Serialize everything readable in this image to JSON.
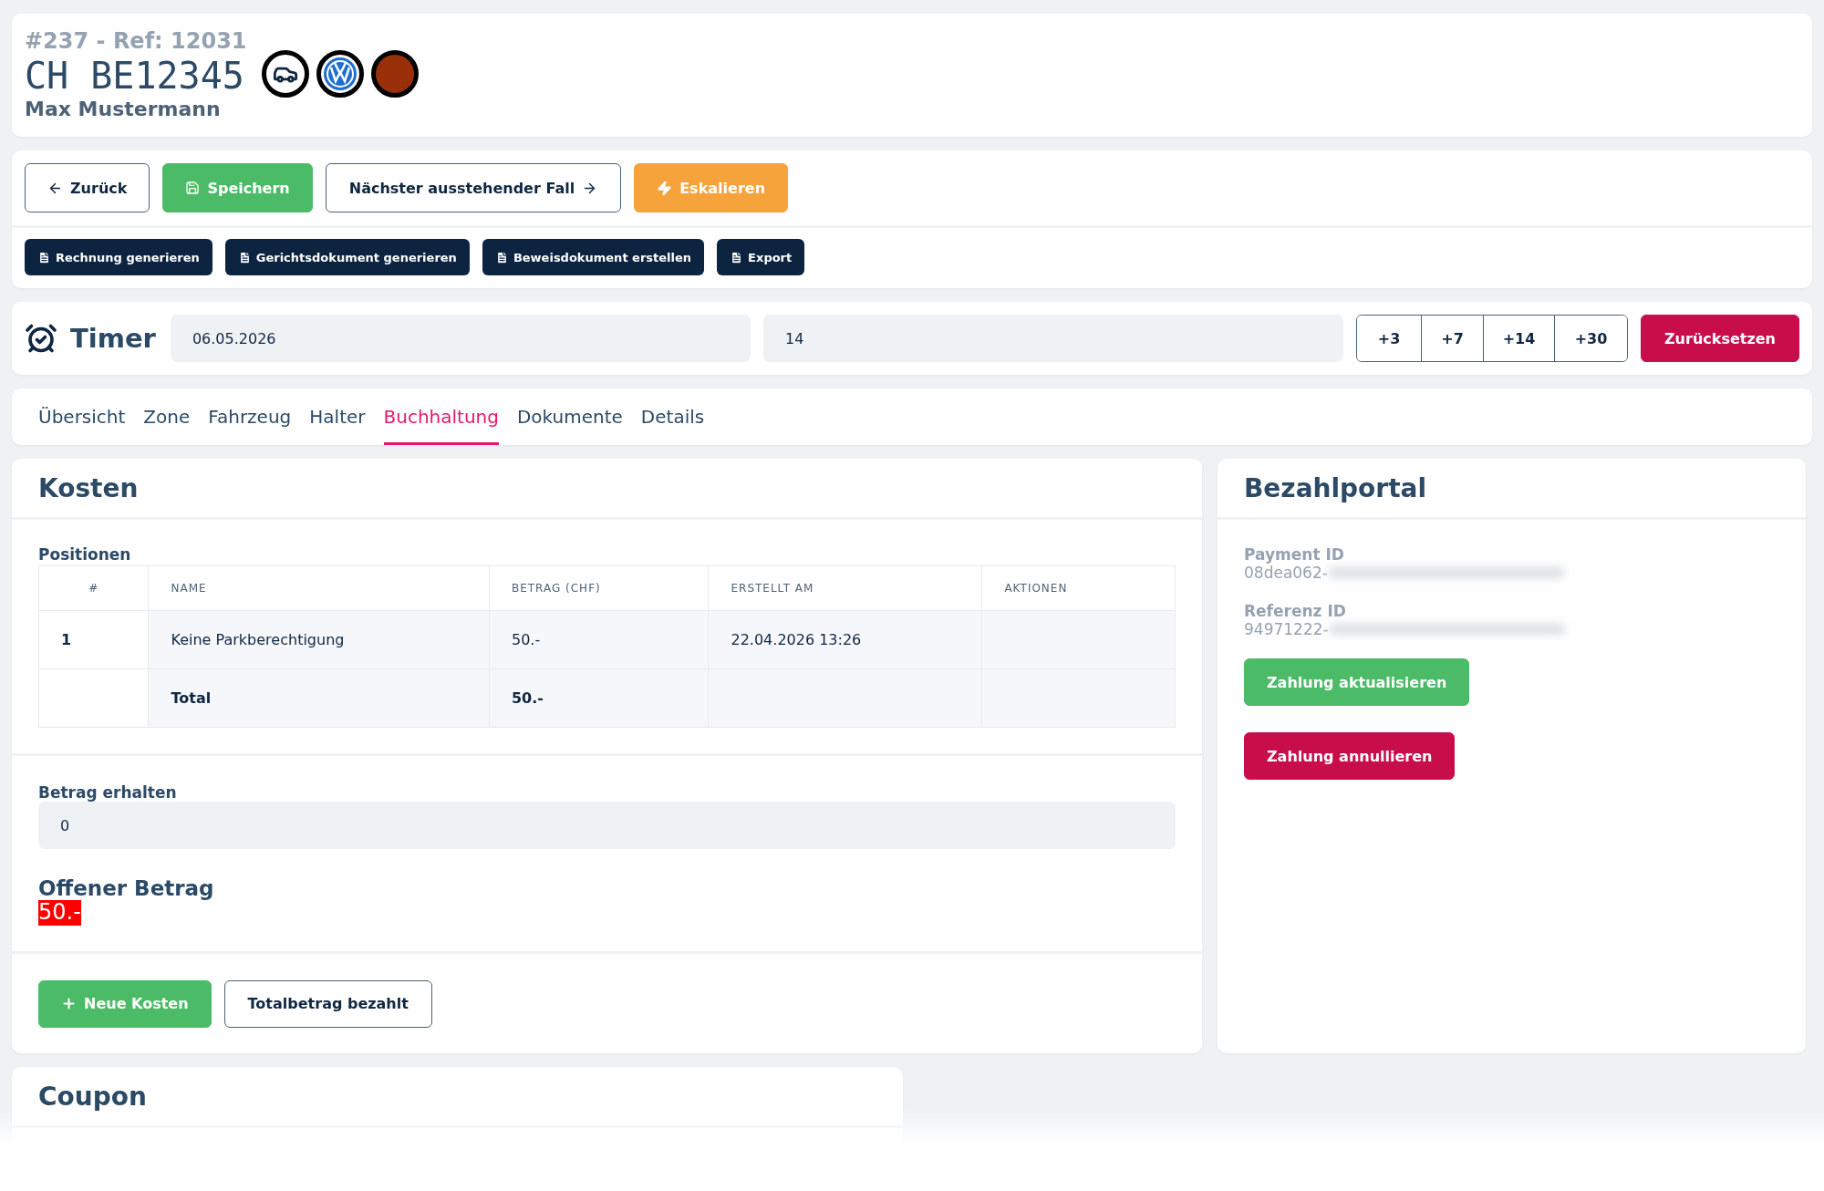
{
  "header": {
    "case_ref": "#237 - Ref: 12031",
    "plate": "CH BE12345",
    "owner": "Max Mustermann",
    "badges": [
      {
        "kind": "car"
      },
      {
        "kind": "brand"
      },
      {
        "kind": "color",
        "color": "#9a300a"
      }
    ]
  },
  "actions": [
    {
      "label": "Zurück",
      "kind": "back"
    },
    {
      "label": "Speichern",
      "kind": "save"
    },
    {
      "label": "Nächster ausstehender Fall",
      "kind": "next"
    },
    {
      "label": "Eskalieren",
      "kind": "escalate"
    }
  ],
  "documents": [
    {
      "label": "Rechnung generieren"
    },
    {
      "label": "Gerichtsdokument generieren"
    },
    {
      "label": "Beweisdokument erstellen"
    },
    {
      "label": "Export"
    }
  ],
  "timer": {
    "label": "Timer",
    "date": "06.05.2026",
    "days": "14",
    "increments": [
      "+3",
      "+7",
      "+14",
      "+30"
    ],
    "reset": "Zurücksetzen"
  },
  "tabs": [
    {
      "label": "Übersicht",
      "selected": false
    },
    {
      "label": "Zone",
      "selected": false
    },
    {
      "label": "Fahrzeug",
      "selected": false
    },
    {
      "label": "Halter",
      "selected": false
    },
    {
      "label": "Buchhaltung",
      "selected": true
    },
    {
      "label": "Dokumente",
      "selected": false
    },
    {
      "label": "Details",
      "selected": false
    }
  ],
  "costs": {
    "title": "Kosten",
    "table_title": "Positionen",
    "columns": [
      "#",
      "NAME",
      "BETRAG (CHF)",
      "ERSTELLT AM",
      "AKTIONEN"
    ],
    "rows": [
      [
        "1",
        "Keine Parkberechtigung",
        "50.-",
        "22.04.2026 13:26",
        ""
      ]
    ],
    "total": {
      "label": "Total",
      "amount": "50.-"
    },
    "received": {
      "label": "Betrag erhalten",
      "value": "0"
    },
    "open": {
      "label": "Offener Betrag",
      "amount": "50.-"
    },
    "buttons": [
      {
        "label": "Neue Kosten",
        "kind": "add"
      },
      {
        "label": "Totalbetrag bezahlt",
        "kind": "outline"
      }
    ]
  },
  "payment": {
    "title": "Bezahlportal",
    "fields": [
      {
        "label": "Payment ID",
        "value": "08dea062-"
      },
      {
        "label": "Referenz ID",
        "value": "94971222-"
      }
    ],
    "buttons": [
      {
        "label": "Zahlung aktualisieren",
        "kind": "update"
      },
      {
        "label": "Zahlung annullieren",
        "kind": "cancel"
      }
    ]
  },
  "coupon": {
    "title": "Coupon"
  }
}
